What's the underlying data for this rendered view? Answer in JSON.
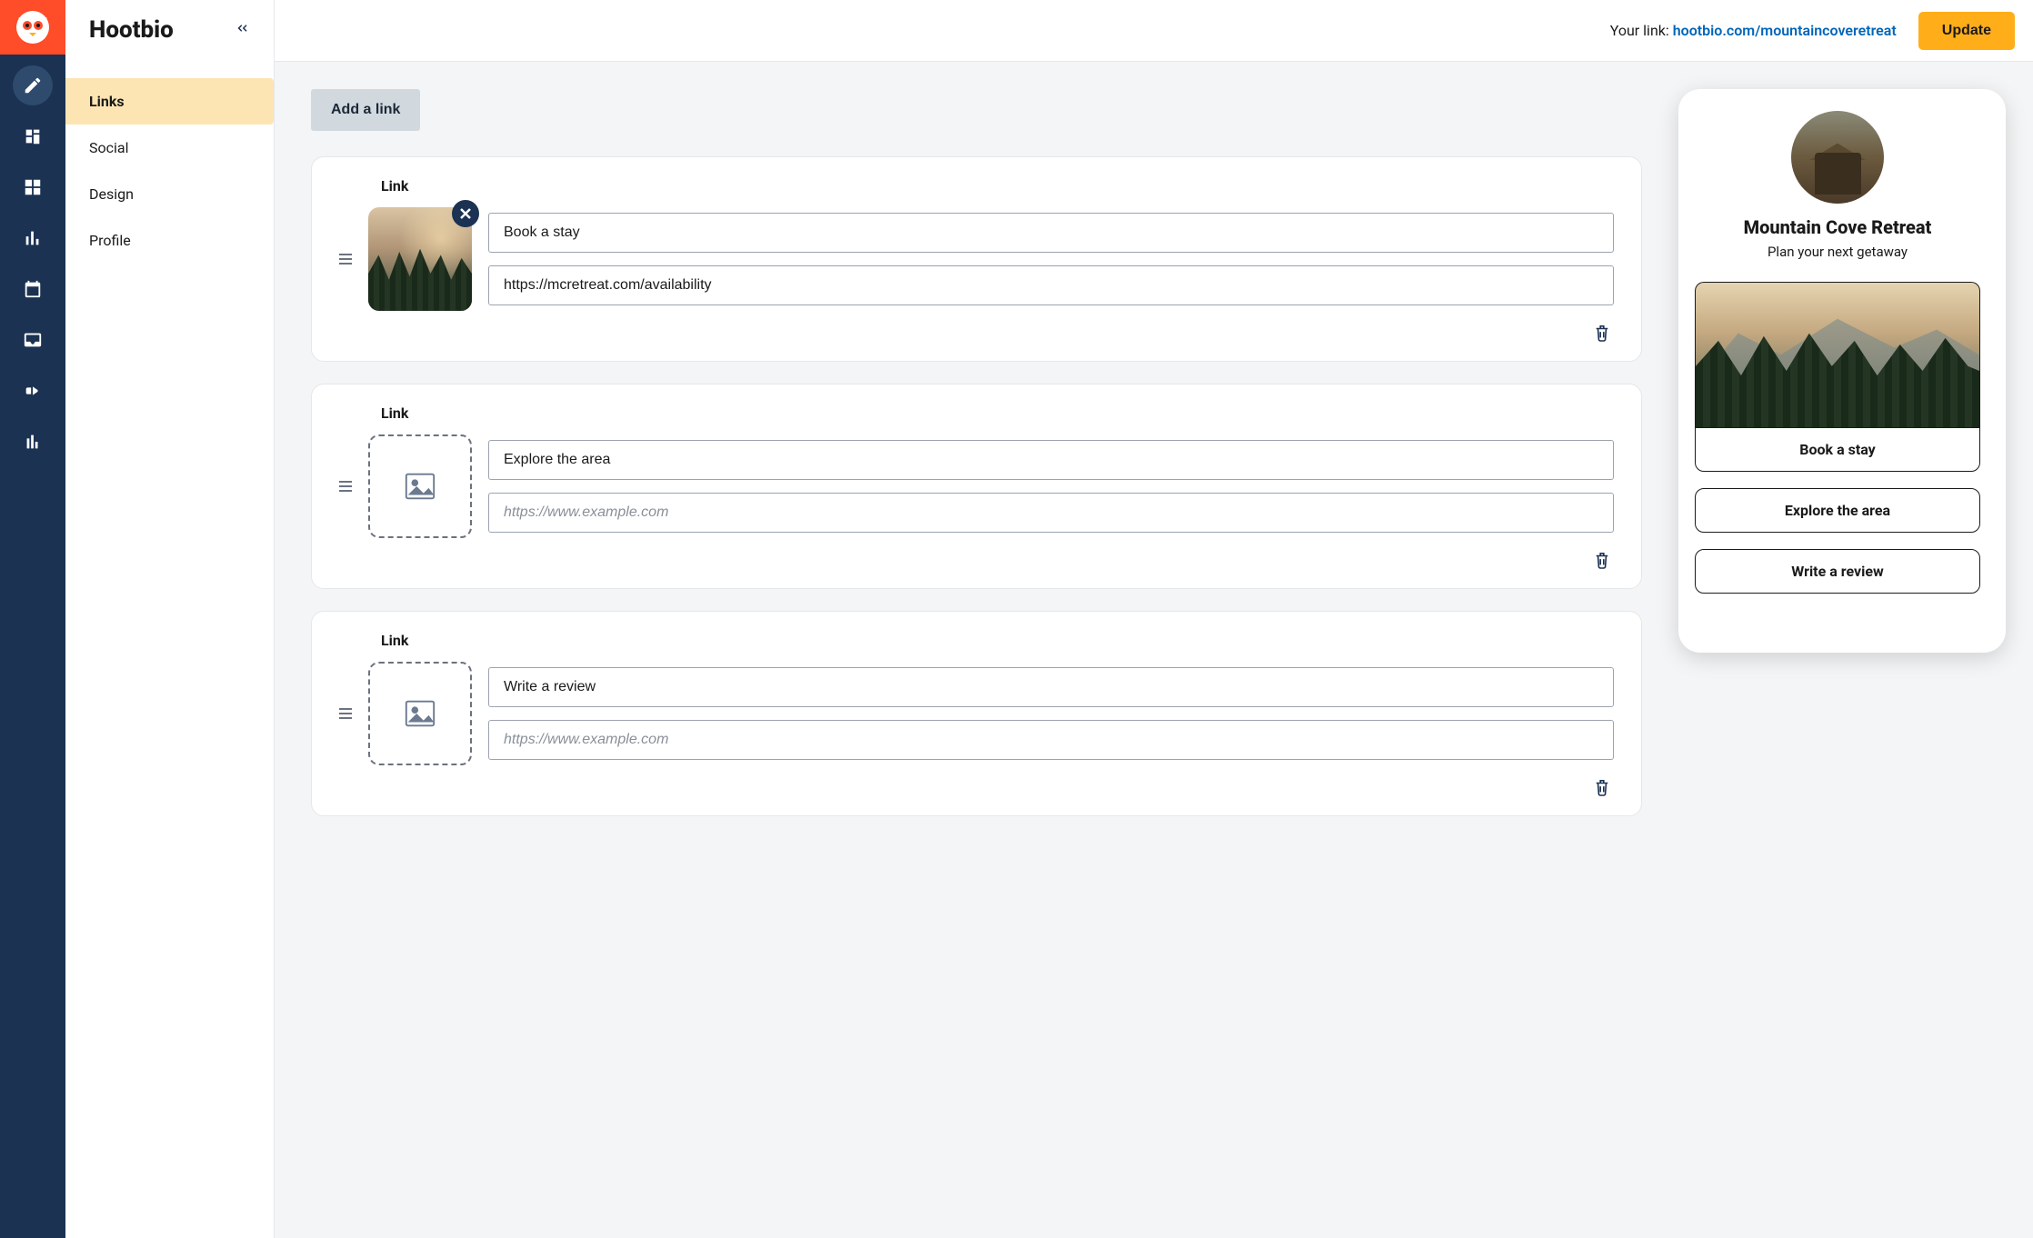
{
  "app_title": "Hootbio",
  "topbar": {
    "your_link_label": "Your link:",
    "your_link_url": "hootbio.com/mountaincoveretreat",
    "update_label": "Update"
  },
  "sidebar": {
    "items": [
      {
        "label": "Links",
        "active": true
      },
      {
        "label": "Social",
        "active": false
      },
      {
        "label": "Design",
        "active": false
      },
      {
        "label": "Profile",
        "active": false
      }
    ]
  },
  "editor": {
    "add_link_label": "Add a link",
    "link_heading": "Link",
    "url_placeholder": "https://www.example.com",
    "links": [
      {
        "title": "Book a stay",
        "url": "https://mcretreat.com/availability",
        "has_image": true
      },
      {
        "title": "Explore the area",
        "url": "",
        "has_image": false
      },
      {
        "title": "Write a review",
        "url": "",
        "has_image": false
      }
    ]
  },
  "preview": {
    "name": "Mountain Cove Retreat",
    "tagline": "Plan your next getaway",
    "buttons": [
      {
        "label": "Book a stay",
        "has_image": true
      },
      {
        "label": "Explore the area",
        "has_image": false
      },
      {
        "label": "Write a review",
        "has_image": false
      }
    ]
  }
}
